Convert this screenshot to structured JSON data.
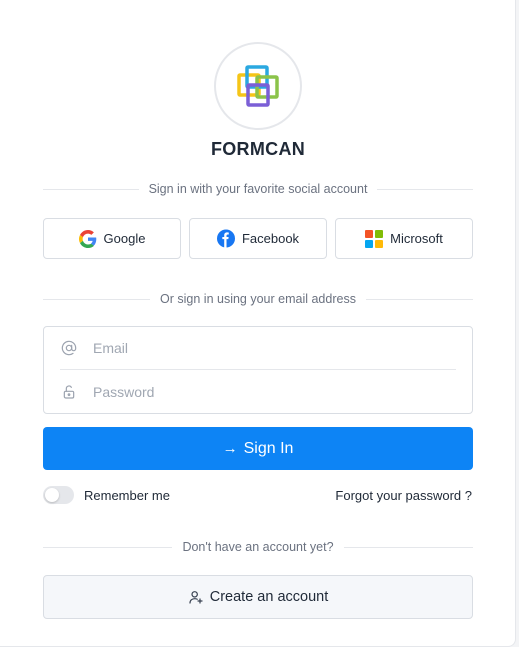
{
  "brand": {
    "name": "FORMCAN",
    "logo_icon": "formcan-logo-icon"
  },
  "social": {
    "divider_text": "Sign in with your favorite social account",
    "buttons": [
      {
        "label": "Google",
        "icon": "google-icon"
      },
      {
        "label": "Facebook",
        "icon": "facebook-icon"
      },
      {
        "label": "Microsoft",
        "icon": "microsoft-icon"
      }
    ]
  },
  "email_divider_text": "Or sign in using your email address",
  "form": {
    "email": {
      "placeholder": "Email",
      "value": "",
      "icon": "at-icon"
    },
    "password": {
      "placeholder": "Password",
      "value": "",
      "icon": "lock-icon"
    }
  },
  "signin_button": {
    "label": "Sign In",
    "icon": "arrow-right-icon"
  },
  "remember_me": {
    "label": "Remember me",
    "checked": false
  },
  "forgot_link": "Forgot your password ?",
  "signup": {
    "divider_text": "Don't have an account yet?",
    "button_label": "Create an account",
    "icon": "user-add-icon"
  },
  "colors": {
    "primary": "#0d84f5",
    "logo_yellow": "#f5c518",
    "logo_blue": "#2ba8e0",
    "logo_green": "#8bc34a",
    "logo_purple": "#7b5fd6"
  }
}
